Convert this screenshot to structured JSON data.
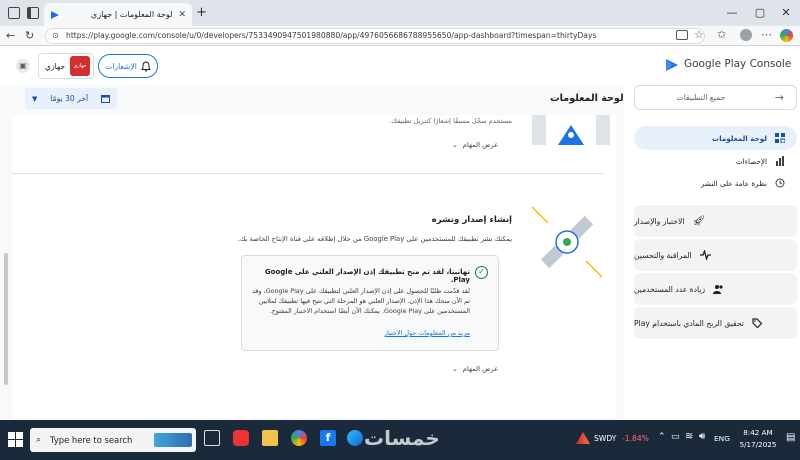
{
  "browser": {
    "tab_title": "لوحة المعلومات | جهازي",
    "new_tab_symbol": "+",
    "url": "https://play.google.com/console/u/0/developers/7533490947501980880/app/4976056686788955650/app-dashboard?timespan=thirtyDays",
    "window_controls": [
      "—",
      "▢",
      "✕"
    ]
  },
  "appbar": {
    "brand": "Google Play Console",
    "notifications_label": "الإشعارات",
    "app_name": "جهازي",
    "app_icon_text": "جهازي"
  },
  "sidebar": {
    "all_apps": "جميع التطبيقات",
    "items": [
      {
        "label": "لوحة المعلومات",
        "icon": "dashboard-icon",
        "active": true
      },
      {
        "label": "الإحصاءات",
        "icon": "bar-chart-icon"
      },
      {
        "label": "نظرة عامة على النشر",
        "icon": "history-icon"
      }
    ],
    "sections": [
      {
        "label": "الاختبار والإصدار",
        "icon": "rocket-icon"
      },
      {
        "label": "المراقبة والتحسين",
        "icon": "pulse-icon"
      },
      {
        "label": "زيادة عدد المستخدمين",
        "icon": "users-icon"
      },
      {
        "label": "تحقيق الربح المادي باستخدام Play",
        "icon": "tag-icon"
      }
    ]
  },
  "main": {
    "page_title": "لوحة المعلومات",
    "timespan": "آخر 30 يومًا",
    "task_top_text": "مستخدم سجّل مسبقًا إشعارًا كتنزيل تطبيقك.",
    "view_tasks": "عرض المهام",
    "section": {
      "title": "إنشاء إصدار ونشره",
      "description": "يمكنك نشر تطبيقك للمستخدمين على Google Play من خلال إطلاقه على قناة الإنتاج الخاصة بك.",
      "alert_title": "تهانينا، لقد تم منح تطبيقك إذن الإصدار العلني على Google Play.",
      "alert_body": "لقد قدّمت طلبًا للحصول على إذن الإصدار العلني لتطبيقك على Google Play، وقد تم الآن منحك هذا الإذن. الإصدار العلني هو المرحلة التي تتيح فيها تطبيقك لملايين المستخدمين على Google Play. يمكنك الآن أيضًا استخدام الاختبار المفتوح.",
      "alert_link": "مزيد من المعلومات حول الاختبار"
    },
    "view_tasks_2": "عرض المهام"
  },
  "taskbar": {
    "search_placeholder": "Type here to search",
    "ticker": "SWDY",
    "ticker_change": "-1.84%",
    "lang": "ENG",
    "time": "8:42 AM",
    "date": "5/17/2025",
    "watermark": "خمسات"
  },
  "colors": {
    "accent": "#1a73e8",
    "active_nav": "#e8f0fe",
    "success": "#188038",
    "taskbar": "#1b2a3b"
  }
}
